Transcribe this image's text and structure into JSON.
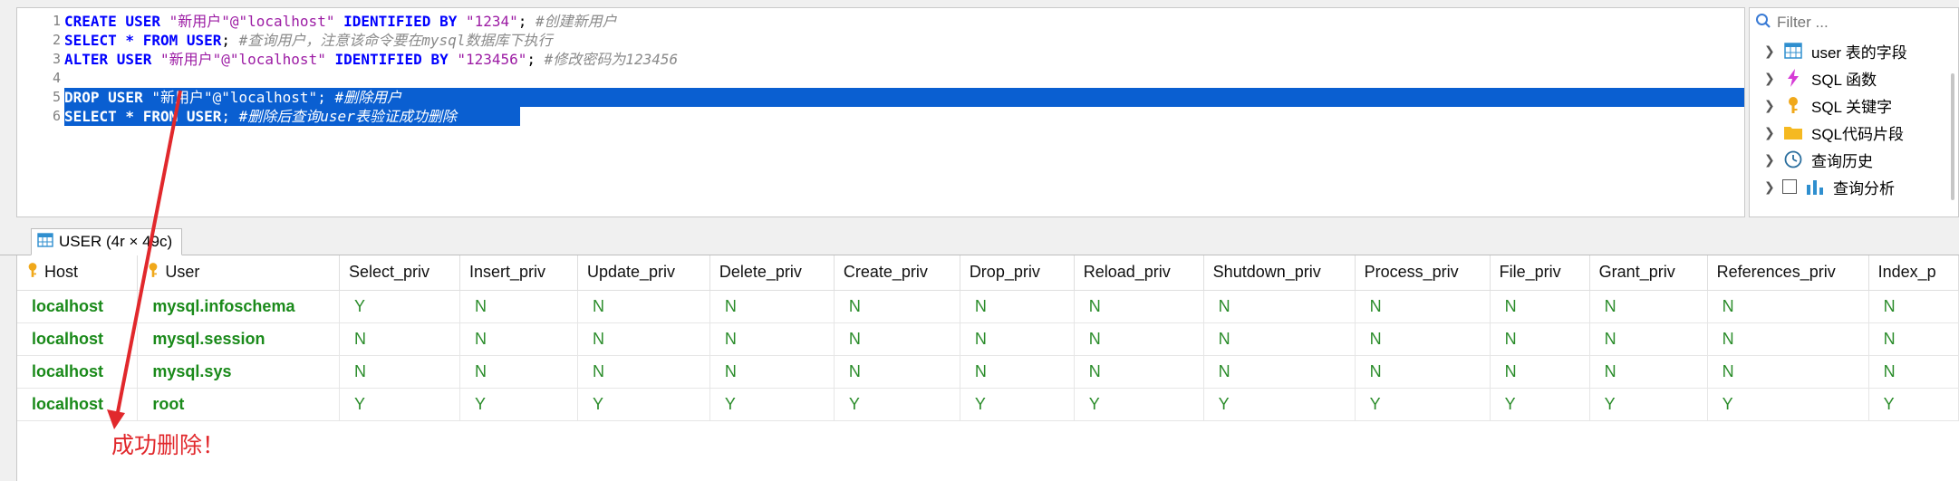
{
  "editor": {
    "line_numbers": [
      "1",
      "2",
      "3",
      "4",
      "5",
      "6"
    ],
    "lines": [
      {
        "kw1": "CREATE USER ",
        "st1": "\"新用户\"@\"localhost\"",
        "kw2": " IDENTIFIED BY ",
        "st2": "\"1234\"",
        "p": "; ",
        "cm": "#创建新用户"
      },
      {
        "kw1": "SELECT * FROM USER",
        "p": "; ",
        "cm": "#查询用户，注意该命令要在mysql数据库下执行"
      },
      {
        "kw1": "ALTER USER ",
        "st1": "\"新用户\"@\"localhost\"",
        "kw2": " IDENTIFIED BY ",
        "st2": "\"123456\"",
        "p": "; ",
        "cm": "#修改密码为123456"
      },
      {},
      {
        "kw1": "DROP USER ",
        "st1": "\"新用户\"@\"localhost\"",
        "p": "; ",
        "cm": "#删除用户"
      },
      {
        "kw1": "SELECT * FROM USER",
        "p": "; ",
        "cm": "#删除后查询user表验证成功删除"
      }
    ]
  },
  "side": {
    "filter_placeholder": "Filter ...",
    "items": [
      "user 表的字段",
      "SQL 函数",
      "SQL 关键字",
      "SQL代码片段",
      "查询历史",
      "查询分析"
    ]
  },
  "tab": {
    "label": "USER (4r × 49c)"
  },
  "grid": {
    "columns": [
      "Host",
      "User",
      "Select_priv",
      "Insert_priv",
      "Update_priv",
      "Delete_priv",
      "Create_priv",
      "Drop_priv",
      "Reload_priv",
      "Shutdown_priv",
      "Process_priv",
      "File_priv",
      "Grant_priv",
      "References_priv",
      "Index_p"
    ],
    "rows": [
      [
        "localhost",
        "mysql.infoschema",
        "Y",
        "N",
        "N",
        "N",
        "N",
        "N",
        "N",
        "N",
        "N",
        "N",
        "N",
        "N",
        "N"
      ],
      [
        "localhost",
        "mysql.session",
        "N",
        "N",
        "N",
        "N",
        "N",
        "N",
        "N",
        "N",
        "N",
        "N",
        "N",
        "N",
        "N"
      ],
      [
        "localhost",
        "mysql.sys",
        "N",
        "N",
        "N",
        "N",
        "N",
        "N",
        "N",
        "N",
        "N",
        "N",
        "N",
        "N",
        "N"
      ],
      [
        "localhost",
        "root",
        "Y",
        "Y",
        "Y",
        "Y",
        "Y",
        "Y",
        "Y",
        "Y",
        "Y",
        "Y",
        "Y",
        "Y",
        "Y"
      ]
    ]
  },
  "annotation": {
    "text": "成功删除！",
    "color": "#e1282c"
  }
}
